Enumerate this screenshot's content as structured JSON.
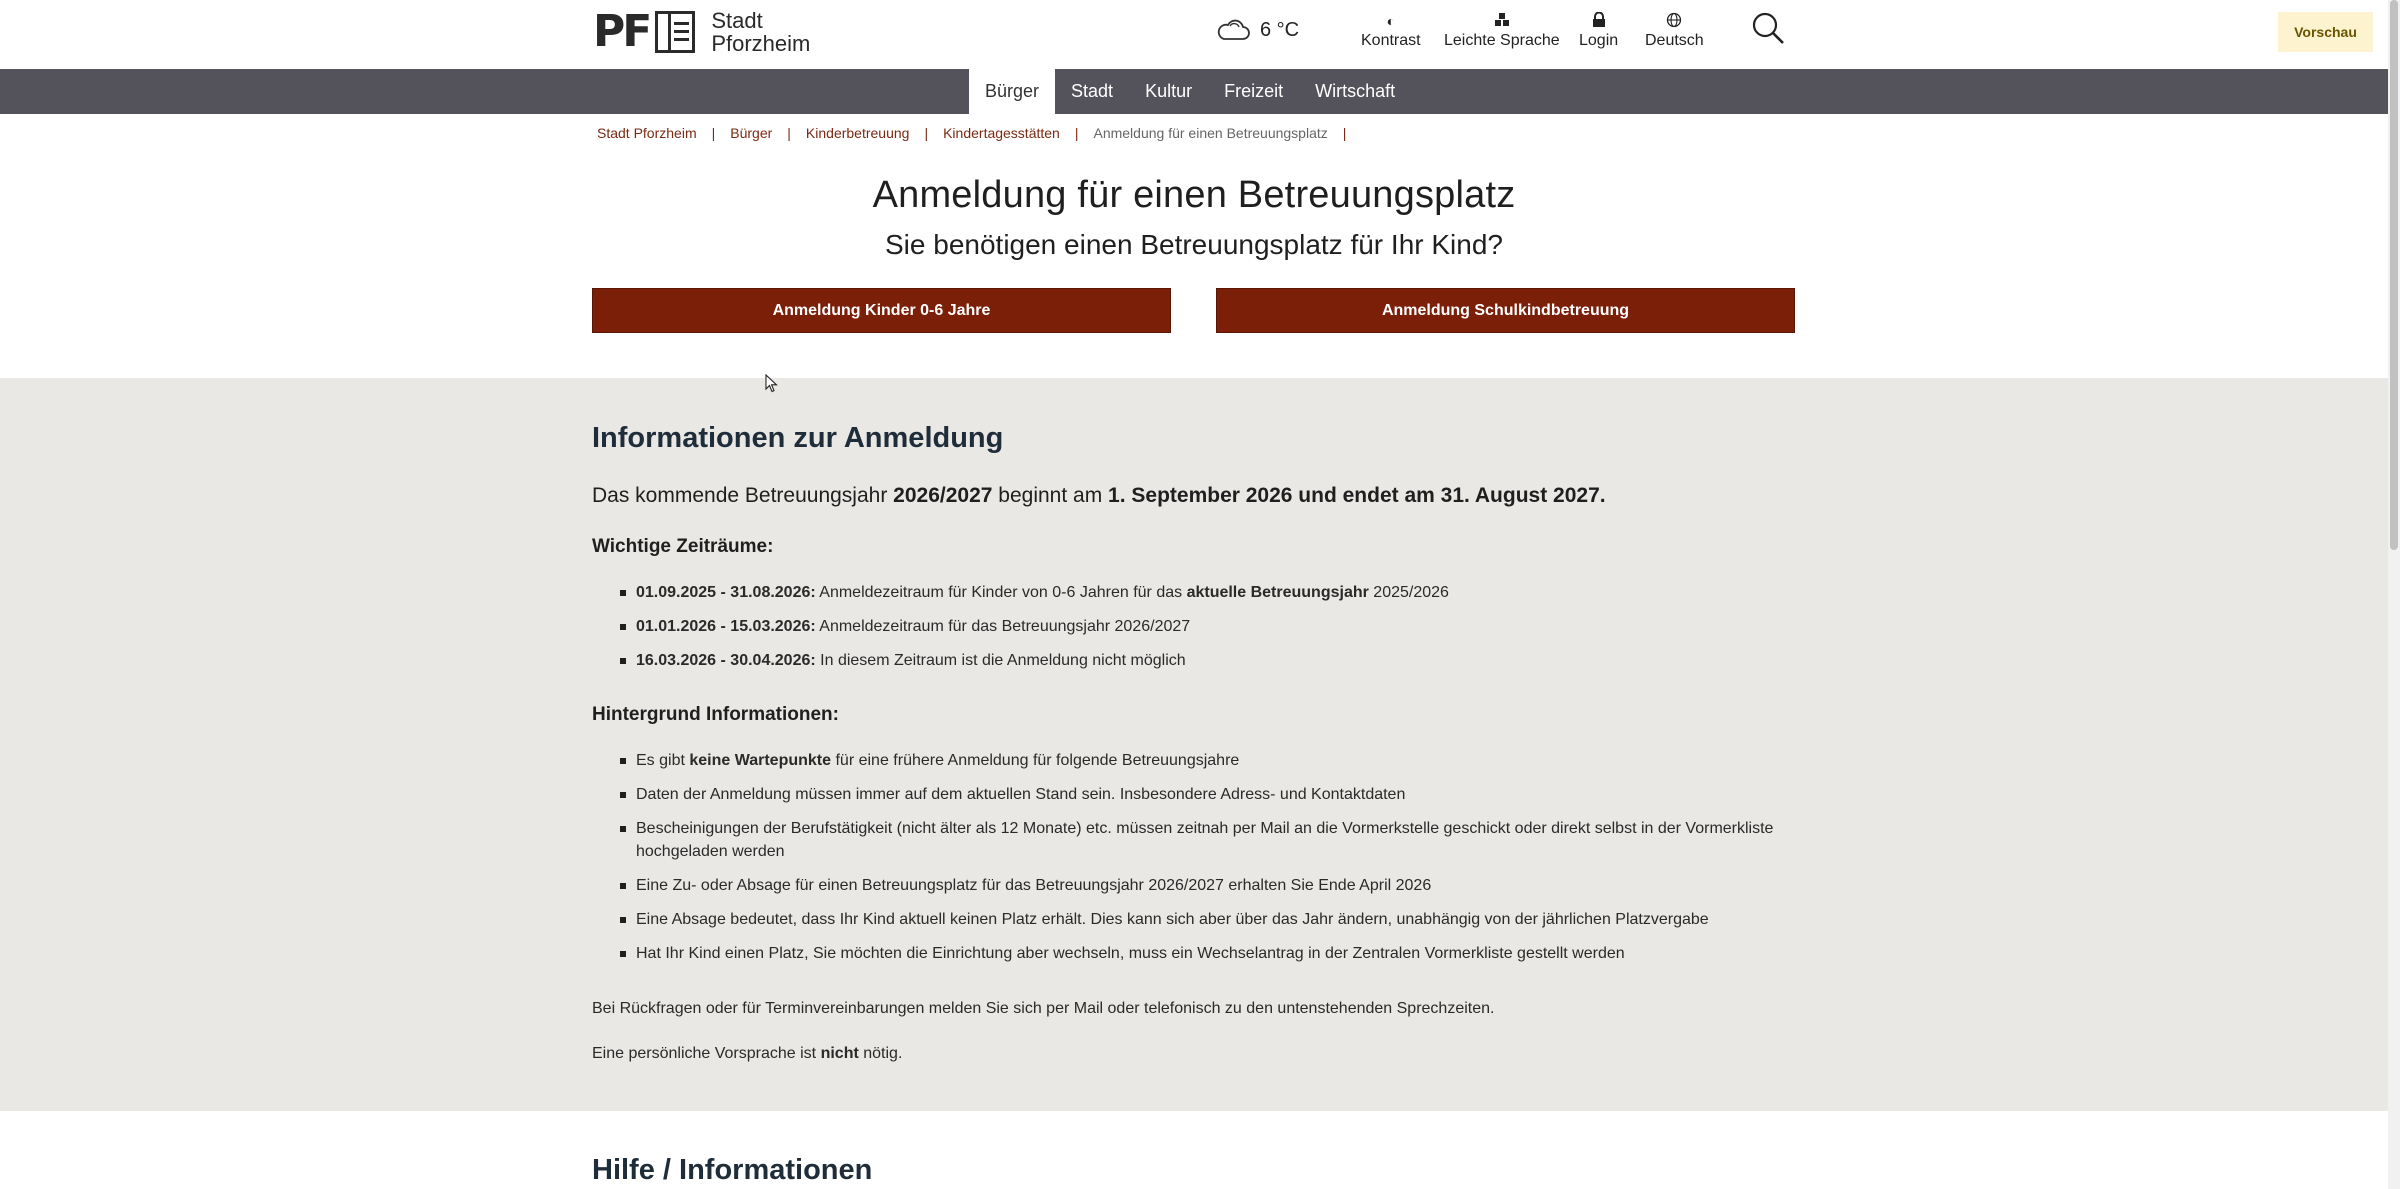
{
  "header": {
    "logo_mark": "PF",
    "logo_line1": "Stadt",
    "logo_line2": "Pforzheim",
    "weather_temp": "6 °C",
    "weather_icon": "cloud-icon",
    "kontrast": "Kontrast",
    "leichte_sprache": "Leichte Sprache",
    "login": "Login",
    "language": "Deutsch",
    "preview": "Vorschau"
  },
  "nav": {
    "items": [
      "Bürger",
      "Stadt",
      "Kultur",
      "Freizeit",
      "Wirtschaft"
    ],
    "active": "Bürger"
  },
  "breadcrumb": [
    "Stadt Pforzheim",
    "Bürger",
    "Kinderbetreuung",
    "Kindertagesstätten",
    "Anmeldung für einen Betreuungsplatz"
  ],
  "page": {
    "title": "Anmeldung für einen Betreuungsplatz",
    "subtitle": "Sie benötigen einen Betreuungsplatz für Ihr Kind?",
    "cta1": "Anmeldung Kinder 0-6 Jahre",
    "cta2": "Anmeldung Schulkindbetreuung"
  },
  "info": {
    "heading": "Informationen zur Anmeldung",
    "lead_a": "Das kommende Betreuungsjahr ",
    "lead_b": "2026/2027",
    "lead_c": " beginnt am ",
    "lead_d": "1. September 2026 und endet am 31. August 2027.",
    "zeitraeume_heading": "Wichtige Zeiträume:",
    "z1_date": "01.09.2025 - 31.08.2026:",
    "z1_text_a": " Anmeldezeitraum für Kinder von 0-6 Jahren für das ",
    "z1_text_b": "aktuelle Betreuungsjahr",
    "z1_text_c": " 2025/2026",
    "z2_date": "01.01.2026 - 15.03.2026:",
    "z2_text": " Anmeldezeitraum für das Betreuungsjahr 2026/2027",
    "z3_date": "16.03.2026 - 30.04.2026:",
    "z3_text": " In diesem Zeitraum ist die Anmeldung nicht möglich",
    "hintergrund_heading": "Hintergrund Informationen:",
    "h1_a": "Es gibt ",
    "h1_b": "keine Wartepunkte",
    "h1_c": " für eine frühere Anmeldung für folgende Betreuungsjahre",
    "h2": "Daten der Anmeldung müssen immer auf dem aktuellen Stand sein. Insbesondere Adress- und Kontaktdaten",
    "h3": "Bescheinigungen der Berufstätigkeit (nicht älter als 12 Monate) etc. müssen zeitnah per Mail an die Vormerkstelle geschickt oder direkt selbst in der Vormerkliste hochgeladen werden",
    "h4": "Eine Zu- oder Absage für einen Betreuungsplatz für das Betreuungsjahr 2026/2027 erhalten Sie Ende April 2026",
    "h5": "Eine Absage bedeutet, dass Ihr Kind aktuell keinen Platz erhält. Dies kann sich aber über das Jahr ändern, unabhängig von der jährlichen Platzvergabe",
    "h6": "Hat Ihr Kind einen Platz, Sie möchten die Einrichtung aber wechseln, muss ein Wechselantrag in der Zentralen Vormerkliste gestellt werden",
    "para1": "Bei Rückfragen oder für Terminvereinbarungen melden Sie sich per Mail oder telefonisch zu den untenstehenden Sprechzeiten.",
    "para2_a": "Eine persönliche Vorsprache ist ",
    "para2_b": "nicht",
    "para2_c": " nötig."
  },
  "help": {
    "heading": "Hilfe / Informationen"
  }
}
